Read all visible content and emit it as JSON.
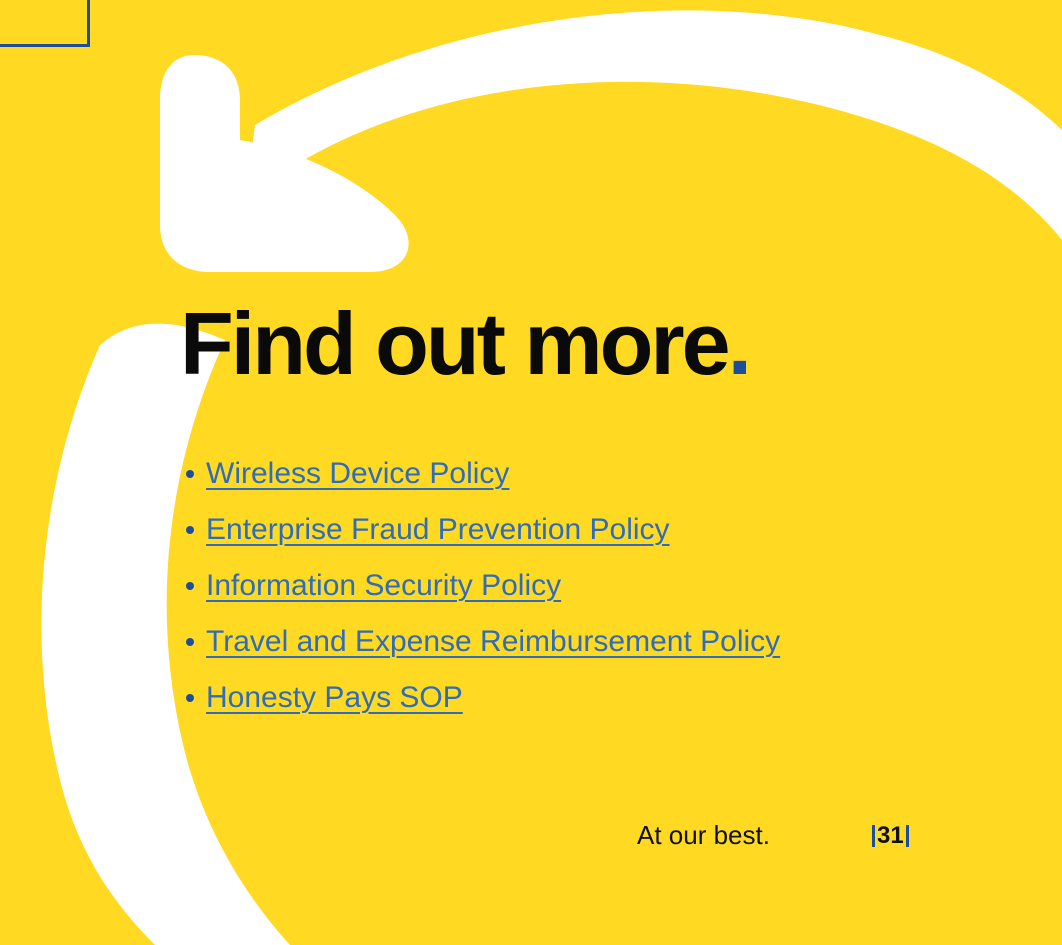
{
  "heading": {
    "text": "Find out more",
    "dot": "."
  },
  "links": [
    {
      "label": "Wireless Device Policy"
    },
    {
      "label": "Enterprise Fraud Prevention Policy"
    },
    {
      "label": "Information Security Policy"
    },
    {
      "label": "Travel and Expense Reimbursement Policy"
    },
    {
      "label": "Honesty Pays SOP"
    }
  ],
  "footer": {
    "tagline": "At our best.",
    "page_number": "31"
  },
  "colors": {
    "background": "#FFD922",
    "accent": "#1D4E9E",
    "link": "#2F6DBB",
    "heading": "#0A0A0A",
    "arrow": "#FFFFFF"
  },
  "icons": {
    "arrow": "circular-arrow-icon",
    "bullet": "bullet-icon"
  }
}
